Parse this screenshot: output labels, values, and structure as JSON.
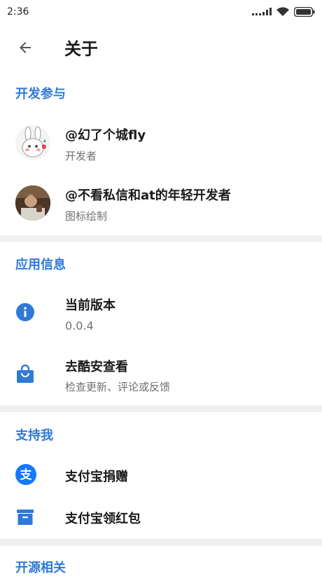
{
  "status_bar": {
    "time": "2:36"
  },
  "header": {
    "title": "关于"
  },
  "sections": {
    "dev": {
      "title": "开发参与",
      "items": [
        {
          "title": "@幻了个城fly",
          "subtitle": "开发者",
          "avatar": "rabbit-avatar"
        },
        {
          "title": "@不看私信和at的年轻开发者",
          "subtitle": "图标绘制",
          "avatar": "person-avatar"
        }
      ]
    },
    "app": {
      "title": "应用信息",
      "items": [
        {
          "title": "当前版本",
          "subtitle": "0.0.4",
          "icon": "info-icon"
        },
        {
          "title": "去酷安查看",
          "subtitle": "检查更新、评论或反馈",
          "icon": "shopping-bag-icon"
        }
      ]
    },
    "support": {
      "title": "支持我",
      "items": [
        {
          "title": "支付宝捐赠",
          "icon": "alipay-icon"
        },
        {
          "title": "支付宝领红包",
          "icon": "archive-box-icon"
        }
      ]
    },
    "opensource": {
      "title": "开源相关"
    }
  },
  "colors": {
    "accent": "#2f7ad8",
    "divider": "#f0f0f0",
    "alipay": "#1677ff"
  }
}
